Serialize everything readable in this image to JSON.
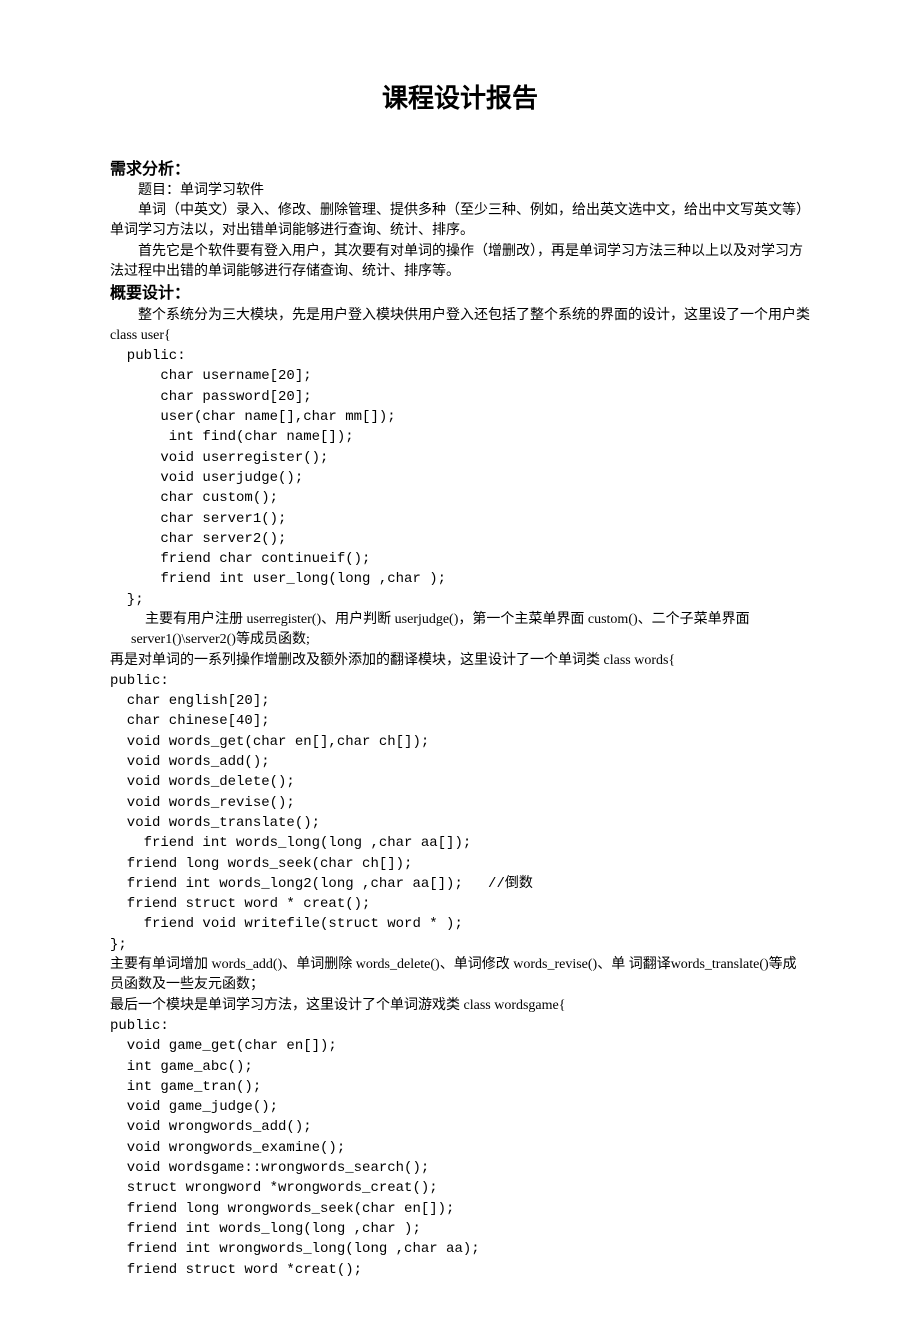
{
  "title": "课程设计报告",
  "section1": {
    "heading": "需求分析：",
    "topic": "题目：单词学习软件",
    "p1": "单词（中英文）录入、修改、删除管理、提供多种（至少三种、例如，给出英文选中文，给出中文写英文等）单词学习方法以，对出错单词能够进行查询、统计、排序。",
    "p2": "首先它是个软件要有登入用户，其次要有对单词的操作（增删改），再是单词学习方法三种以上以及对学习方法过程中出错的单词能够进行存储查询、统计、排序等。"
  },
  "section2": {
    "heading": "概要设计：",
    "p1": "整个系统分为三大模块，先是用户登入模块供用户登入还包括了整个系统的界面的设计，这里设了一个用户类 class user{",
    "code1": "  public:\n      char username[20];\n      char password[20];\n      user(char name[],char mm[]);\n       int find(char name[]);\n      void userregister();\n      void userjudge();\n      char custom();\n      char server1();\n      char server2();\n      friend char continueif();\n      friend int user_long(long ,char );\n  };",
    "p2": "主要有用户注册 userregister()、用户判断 userjudge()，第一个主菜单界面 custom()、二个子菜单界面 server1()\\server2()等成员函数;",
    "p3": "再是对单词的一系列操作增删改及额外添加的翻译模块，这里设计了一个单词类 class words{",
    "code2": "public:\n  char english[20];\n  char chinese[40];\n  void words_get(char en[],char ch[]);\n  void words_add();\n  void words_delete();\n  void words_revise();\n  void words_translate();\n    friend int words_long(long ,char aa[]);\n  friend long words_seek(char ch[]);\n  friend int words_long2(long ,char aa[]);   //倒数\n  friend struct word * creat();\n    friend void writefile(struct word * );\n};",
    "p4": "主要有单词增加 words_add()、单词删除 words_delete()、单词修改 words_revise()、单 词翻译words_translate()等成员函数及一些友元函数；",
    "p5": "最后一个模块是单词学习方法，这里设计了个单词游戏类 class wordsgame{",
    "code3": "public:\n  void game_get(char en[]);\n  int game_abc();\n  int game_tran();\n  void game_judge();\n  void wrongwords_add();\n  void wrongwords_examine();\n  void wordsgame::wrongwords_search();\n  struct wrongword *wrongwords_creat();\n  friend long wrongwords_seek(char en[]);\n  friend int words_long(long ,char );\n  friend int wrongwords_long(long ,char aa);\n  friend struct word *creat();"
  }
}
